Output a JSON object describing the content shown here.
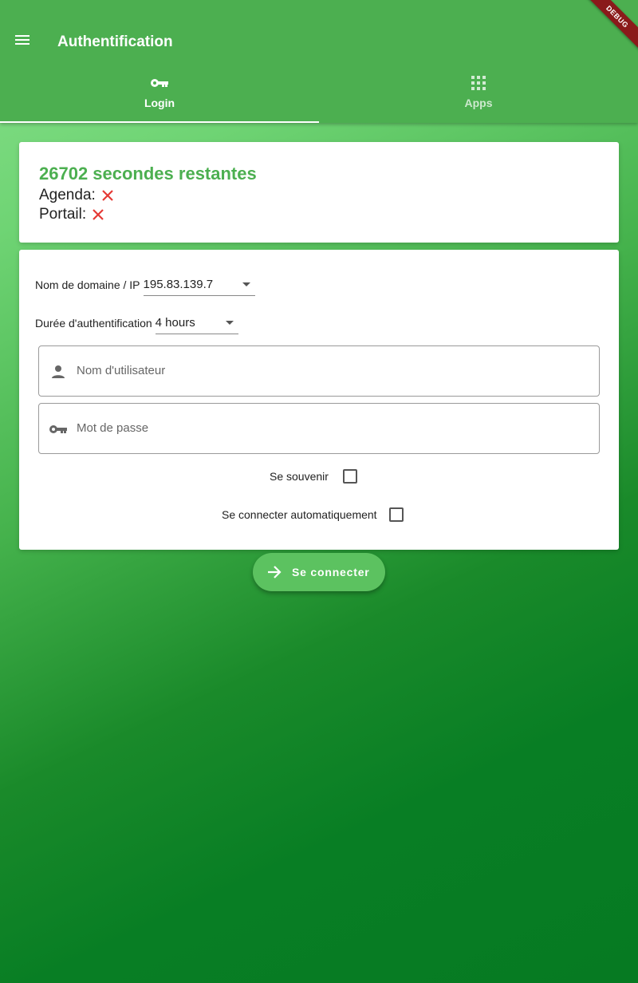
{
  "appbar": {
    "title": "Authentification",
    "menu_icon": "menu-icon",
    "debug_banner": "DEBUG",
    "tabs": [
      {
        "label": "Login",
        "icon": "key-icon",
        "selected": true
      },
      {
        "label": "Apps",
        "icon": "apps-grid-icon",
        "selected": false
      }
    ]
  },
  "status": {
    "timer_text": "26702 secondes restantes",
    "agenda_label": "Agenda:",
    "portail_label": "Portail:",
    "agenda_ok": false,
    "portail_ok": false
  },
  "form": {
    "domain_label": "Nom de domaine / IP",
    "domain_value": "195.83.139.7",
    "duration_label": "Durée d'authentification",
    "duration_value": "4 hours",
    "username_placeholder": "Nom d'utilisateur",
    "password_placeholder": "Mot de passe",
    "remember_label": "Se souvenir",
    "remember_checked": false,
    "autoconnect_label": "Se connecter automatiquement",
    "autoconnect_checked": false
  },
  "actions": {
    "connect_label": "Se connecter"
  },
  "colors": {
    "primary": "#4caf50",
    "error": "#e53935",
    "debug": "#8a1a1a"
  }
}
